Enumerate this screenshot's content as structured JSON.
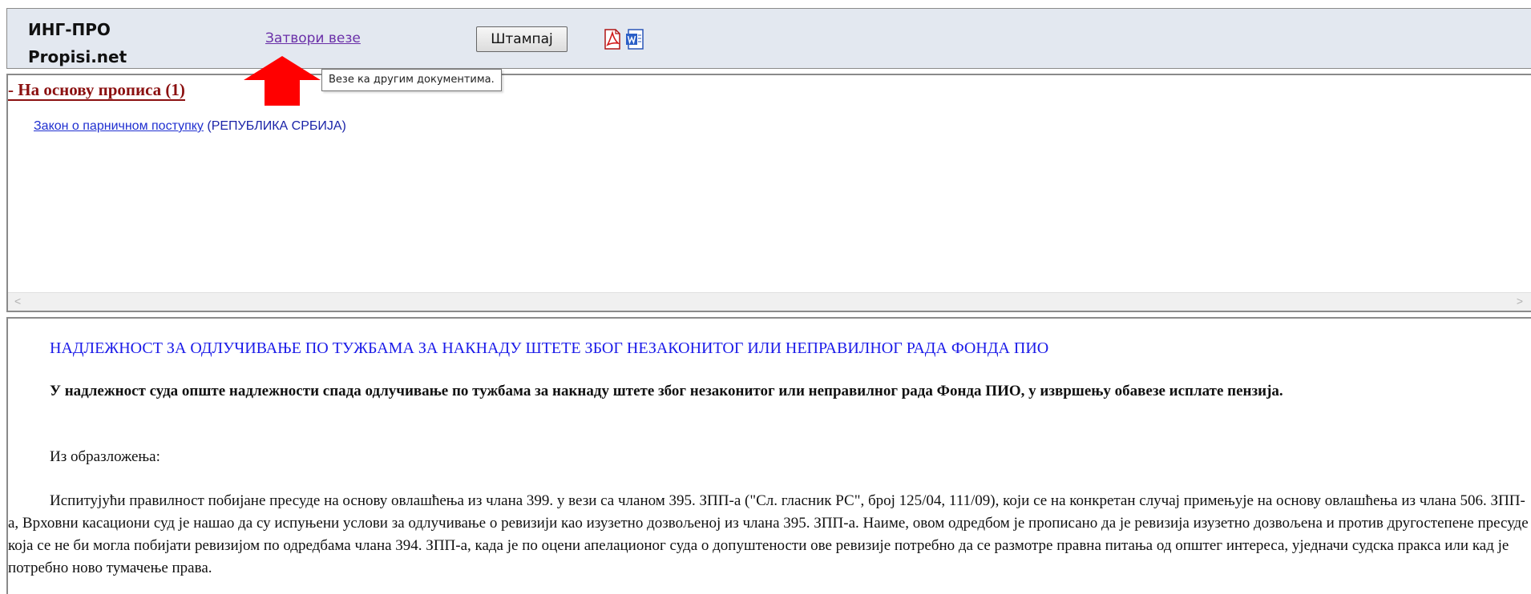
{
  "header": {
    "brand_line1": "ИНГ-ПРО",
    "brand_line2": "Propisi.net",
    "close_links_label": "Затвори везе",
    "print_label": "Штампај",
    "pdf_icon": "pdf-icon",
    "word_icon": "word-icon"
  },
  "tooltip": {
    "text": "Везе ка другим документима."
  },
  "links_panel": {
    "section_heading": "- На основу прописа (1)",
    "reference": {
      "link_text": "Закон о парничном поступку",
      "suffix": " (РЕПУБЛИКА СРБИЈА)"
    },
    "scroll_left": "<",
    "scroll_right": ">"
  },
  "document": {
    "title": "НАДЛЕЖНОСТ ЗА ОДЛУЧИВАЊЕ ПО ТУЖБАМА ЗА НАКНАДУ ШТЕТЕ ЗБОГ НЕЗАКОНИТОГ ИЛИ НЕПРАВИЛНОГ РАДА ФОНДА ПИО",
    "summary": "У надлежност суда опште надлежности спада одлучивање по тужбама за накнаду штете због незаконитог или неправилног рада Фонда ПИО, у извршењу обавезе исплате пензија.",
    "reasons_label": "Из образложења:",
    "paragraph": "Испитујући правилност побијане пресуде на основу овлашћења из члана 399. у вези са чланом 395. ЗПП-а (\"Сл. гласник РС\", број 125/04, 111/09), који се на конкретан случај примењује на основу овлашћења из члана 506. ЗПП-а, Врховни касациони суд је нашао да су испуњени услови за одлучивање о ревизији као изузетно дозвољеној из члана 395. ЗПП-а. Наиме, овом одредбом је прописано да је ревизија изузетно дозвољена и против другостепене пресуде која се не би могла побијати ревизијом по одредбама члана 394. ЗПП-а, када је по оцени апелационог суда о допуштености ове ревизије потребно да се размотре правна питања од општег интереса, уједначи судска пракса или кад је потребно ново тумачење права."
  },
  "colors": {
    "header_bg": "#e3e8f0",
    "heading_red": "#8b1010",
    "title_blue": "#1a1ae8",
    "visited_link": "#6a2fa8",
    "arrow_red": "#ff0000"
  }
}
